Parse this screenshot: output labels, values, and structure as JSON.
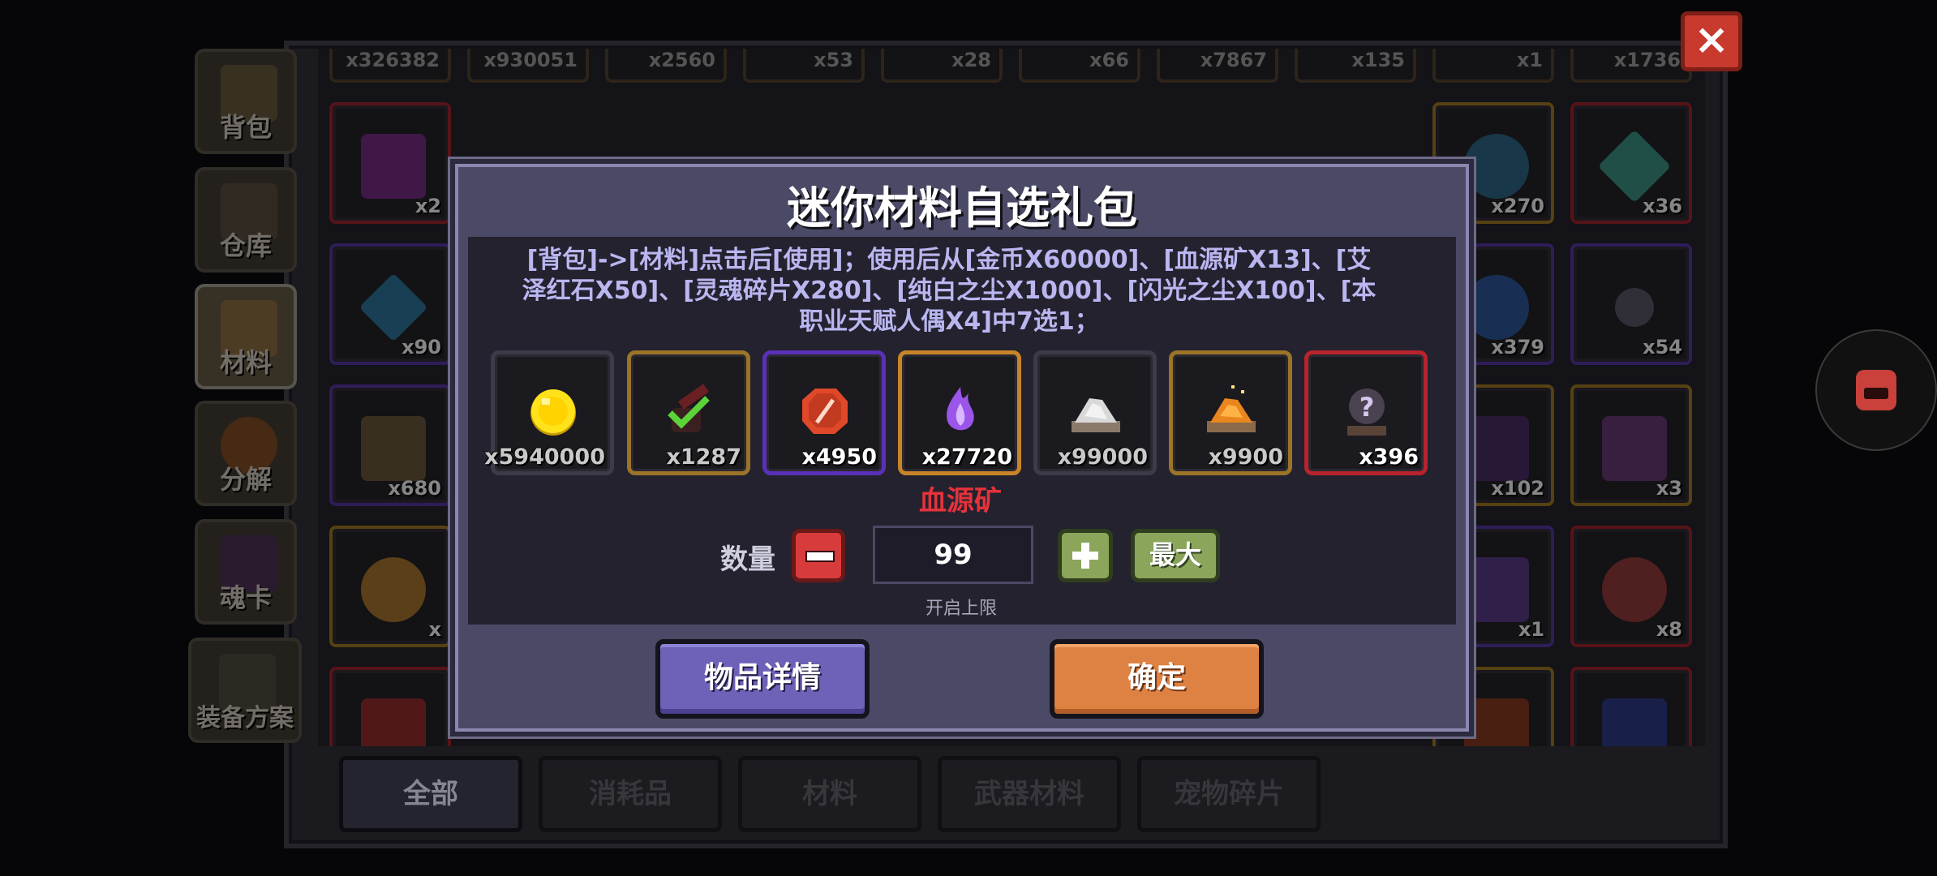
{
  "sidebar": {
    "items": [
      {
        "label": "背包"
      },
      {
        "label": "仓库"
      },
      {
        "label": "材料"
      },
      {
        "label": "分解"
      },
      {
        "label": "魂卡"
      },
      {
        "label": "装备方案"
      }
    ]
  },
  "inventory": {
    "top_strip_counts": [
      "x326382",
      "x930051",
      "x2560",
      "x53",
      "x28",
      "x66",
      "x7867",
      "x135",
      "x1",
      "x1736"
    ],
    "visible_counts": [
      "x2",
      "x270",
      "x36",
      "x90",
      "x379",
      "x54",
      "x680",
      "x102",
      "x3",
      "x",
      "x1",
      "x8"
    ]
  },
  "tabs": [
    {
      "label": "全部"
    },
    {
      "label": "消耗品"
    },
    {
      "label": "材料"
    },
    {
      "label": "武器材料"
    },
    {
      "label": "宠物碎片"
    }
  ],
  "close_icon": "×",
  "modal": {
    "title": "迷你材料自选礼包",
    "description": "[背包]->[材料]点击后[使用]；使用后从[金币X60000]、[血源矿X13]、[艾泽红石X50]、[灵魂碎片X280]、[纯白之尘X1000]、[闪光之尘X100]、[本职业天赋人偶X4]中7选1；",
    "options": [
      {
        "icon": "gold-coin-icon",
        "count": "x5940000"
      },
      {
        "icon": "blood-ore-icon",
        "count": "x1287"
      },
      {
        "icon": "red-stone-icon",
        "count": "x4950"
      },
      {
        "icon": "soul-shard-icon",
        "count": "x27720"
      },
      {
        "icon": "white-dust-icon",
        "count": "x99000"
      },
      {
        "icon": "flash-dust-icon",
        "count": "x9900"
      },
      {
        "icon": "talent-doll-icon",
        "count": "x396"
      }
    ],
    "selected_name": "血源矿",
    "quantity_label": "数量",
    "quantity_value": "99",
    "max_label": "最大",
    "limit_note": "开启上限",
    "details_label": "物品详情",
    "confirm_label": "确定"
  }
}
